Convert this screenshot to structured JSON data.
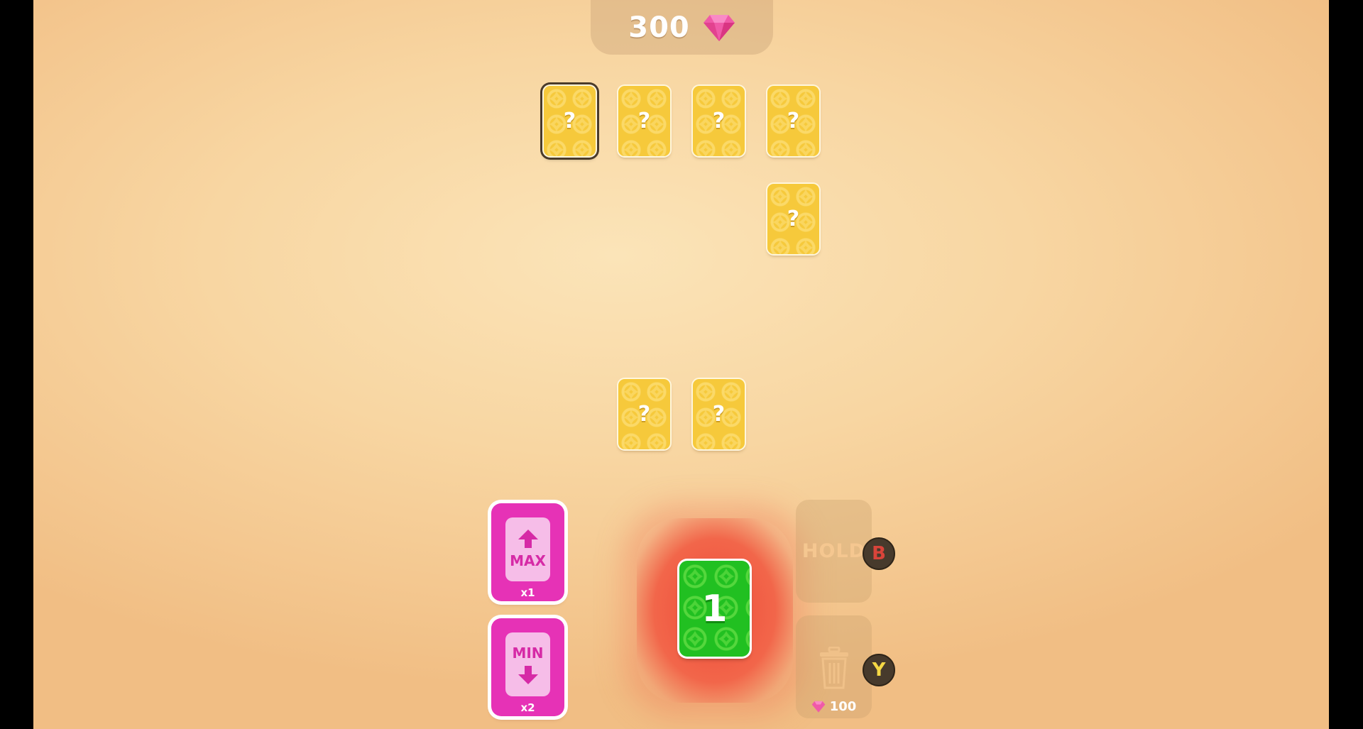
{
  "score": {
    "value": "300",
    "icon": "gem-icon",
    "gem_color": "#f05aa8"
  },
  "grid": {
    "card_label": "?",
    "card_color": "#f6c93b",
    "selected_index": 0
  },
  "powerups": {
    "max": {
      "label": "MAX",
      "count": "x1"
    },
    "min": {
      "label": "MIN",
      "count": "x2"
    },
    "color": "#e632b6"
  },
  "active_card": {
    "value": "1",
    "color": "#21c021"
  },
  "actions": {
    "hold": {
      "label": "HOLD",
      "button": "B",
      "button_color": "#d9443a"
    },
    "discard": {
      "icon": "trash-icon",
      "button": "Y",
      "button_color": "#f5d845",
      "cost": "100"
    }
  }
}
